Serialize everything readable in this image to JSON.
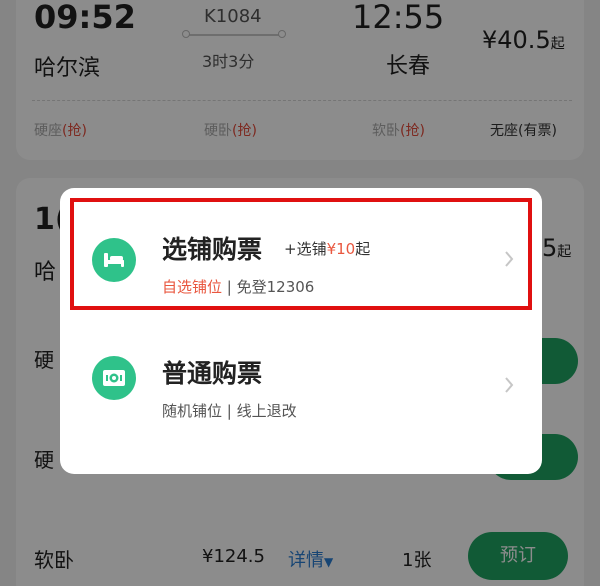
{
  "train": {
    "depart_time": "09:52",
    "depart_station": "哈尔滨",
    "train_no": "K1084",
    "duration": "3时3分",
    "arrive_time": "12:55",
    "arrive_station": "长春",
    "price": "¥40.5",
    "price_suffix": "起",
    "seats": [
      {
        "name": "硬座",
        "status": "(抢)"
      },
      {
        "name": "硬卧",
        "status": "(抢)"
      },
      {
        "name": "软卧",
        "status": "(抢)"
      },
      {
        "name": "无座",
        "status": "(有票)"
      }
    ]
  },
  "second_card": {
    "time_partial": "1(",
    "station_partial": "哈",
    "price_partial": "5",
    "price_suffix": "起",
    "rows": [
      {
        "label": "硬"
      },
      {
        "label": "硬"
      }
    ],
    "soft_sleeper": {
      "label": "软卧",
      "price": "¥124.5",
      "detail": "详情",
      "count": "1张",
      "button": "预订"
    }
  },
  "dialog": {
    "option1": {
      "title": "选铺购票",
      "extra_prefix": "+选铺",
      "extra_price": "¥10",
      "extra_suffix": "起",
      "sub_red": "自选铺位",
      "sub_rest": " | 免登12306",
      "icon": "bed-icon"
    },
    "option2": {
      "title": "普通购票",
      "sub": "随机铺位 | 线上退改",
      "icon": "ticket-icon"
    }
  },
  "colors": {
    "accent_green": "#2fc28a",
    "button_green": "#1fa463",
    "highlight_red": "#e01010",
    "price_red": "#e9573f"
  }
}
